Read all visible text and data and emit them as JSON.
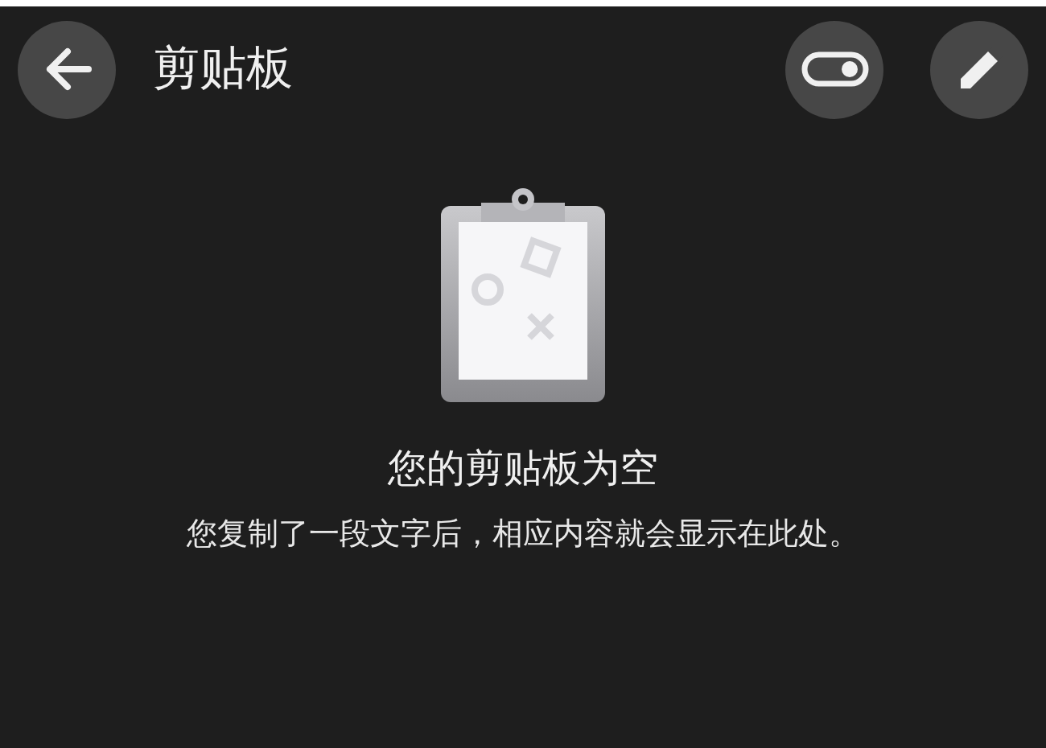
{
  "app_bar": {
    "title": "剪贴板"
  },
  "empty_state": {
    "heading": "您的剪贴板为空",
    "message": "您复制了一段文字后，相应内容就会显示在此处。"
  }
}
